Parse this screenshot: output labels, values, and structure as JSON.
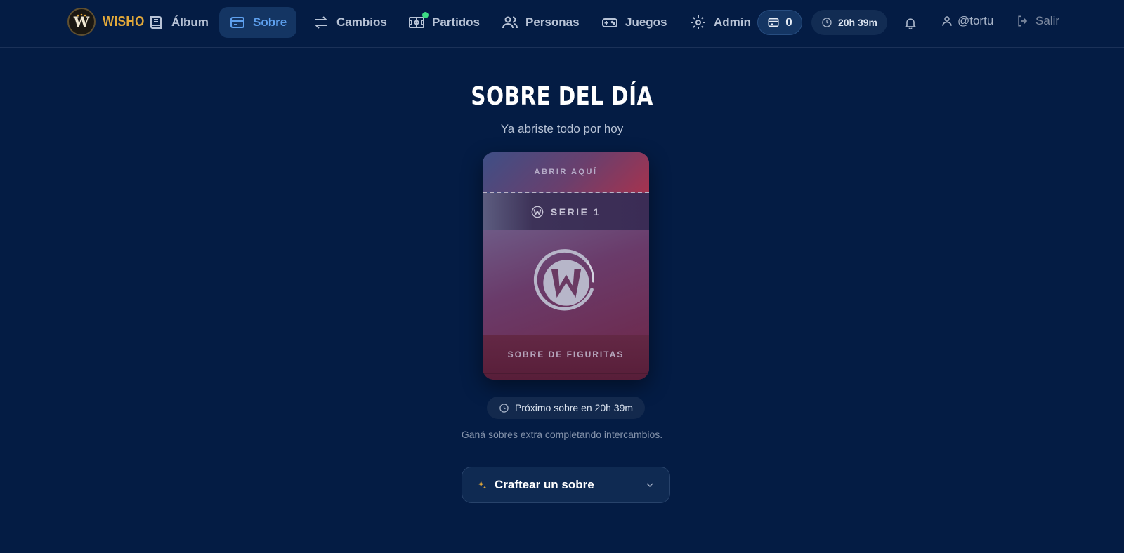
{
  "brand": {
    "name": "WISHO",
    "logo_letter": "W"
  },
  "nav": {
    "album": "Álbum",
    "sobre": "Sobre",
    "cambios": "Cambios",
    "partidos": "Partidos",
    "personas": "Personas",
    "juegos": "Juegos",
    "admin": "Admin"
  },
  "header": {
    "wallet_count": "0",
    "timer": "20h 39m",
    "username": "@tortu",
    "logout": "Salir"
  },
  "main": {
    "title": "SOBRE DEL DÍA",
    "subtitle": "Ya abriste todo por hoy",
    "pack": {
      "tear_label": "ABRIR AQUÍ",
      "series": "SERIE 1",
      "bottom_label": "SOBRE DE FIGURITAS"
    },
    "next_pack": "Próximo sobre en 20h 39m",
    "hint": "Ganá sobres extra completando intercambios.",
    "craft_label": "Craftear un sobre"
  },
  "colors": {
    "background": "#041c44",
    "brand_gold": "#e3a93a",
    "active_nav": "#5ea0ee",
    "status_dot": "#3ddc84"
  }
}
